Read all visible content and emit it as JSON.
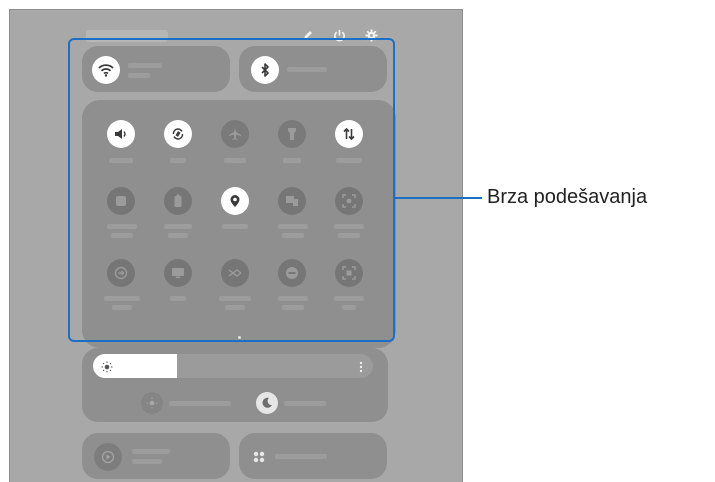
{
  "callout": {
    "label": "Brza podešavanja"
  },
  "brightness": {
    "level": 0.3
  },
  "icons": {
    "edit": "edit-icon",
    "power": "power-icon",
    "settings": "settings-icon",
    "wifi": "wifi-icon",
    "bluetooth": "bluetooth-icon"
  },
  "colors": {
    "accent": "#1c6fc6"
  }
}
